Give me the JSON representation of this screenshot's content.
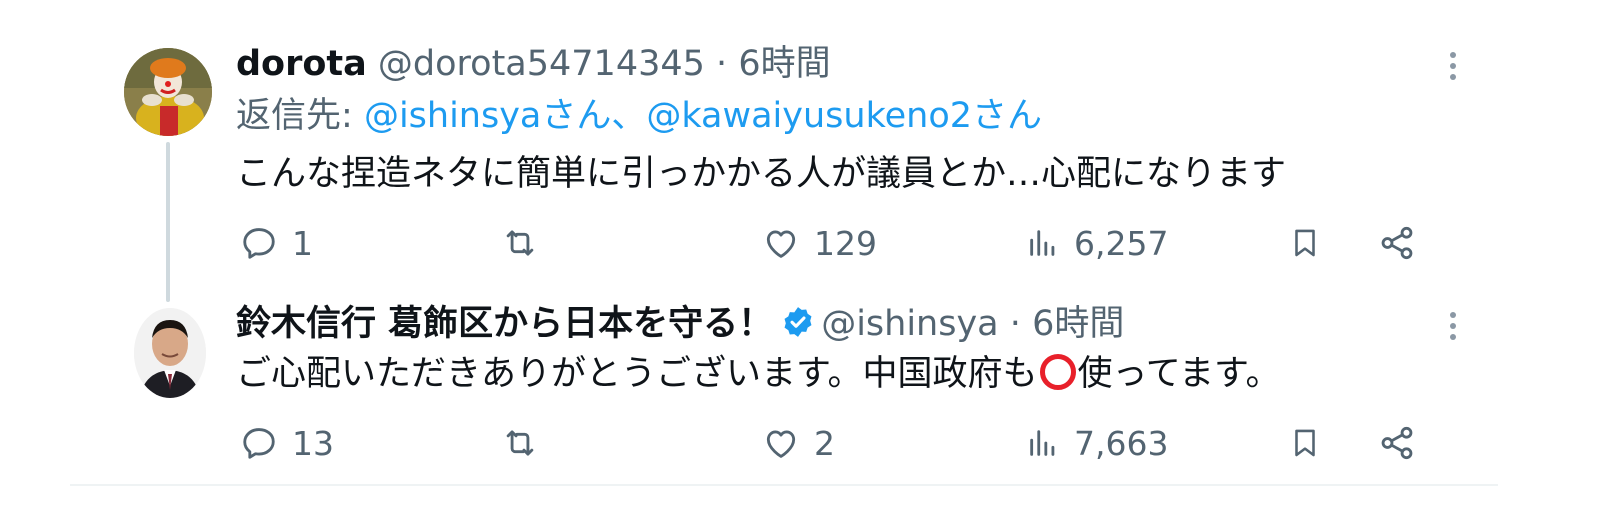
{
  "tweets": [
    {
      "display_name": "dorota",
      "handle": "@dorota54714345",
      "separator": "·",
      "time": "6時間",
      "reply_to_prefix": "返信先:",
      "reply_to_mentions": "@ishinsyaさん、@kawaiyusukeno2さん",
      "text": "こんな捏造ネタに簡単に引っかかる人が議員とか…心配になります",
      "replies": "1",
      "likes": "129",
      "views": "6,257",
      "avatar_icon": "clown-avatar"
    },
    {
      "display_name": "鈴木信行 葛飾区から日本を守る！",
      "verified": true,
      "handle": "@ishinsya",
      "separator": "·",
      "time": "6時間",
      "text_before": "ご心配いただきありがとうございます。中国政府も",
      "text_emoji": "heavy-large-circle",
      "text_after": "使ってます。",
      "replies": "13",
      "likes": "2",
      "views": "7,663",
      "avatar_icon": "man-portrait-avatar"
    }
  ],
  "colors": {
    "text_primary": "#0f1419",
    "text_secondary": "#536471",
    "link": "#1d9bf0",
    "verified_badge": "#1d9bf0",
    "thread_line": "#cfd9de",
    "emoji_circle": "#e8202a"
  }
}
